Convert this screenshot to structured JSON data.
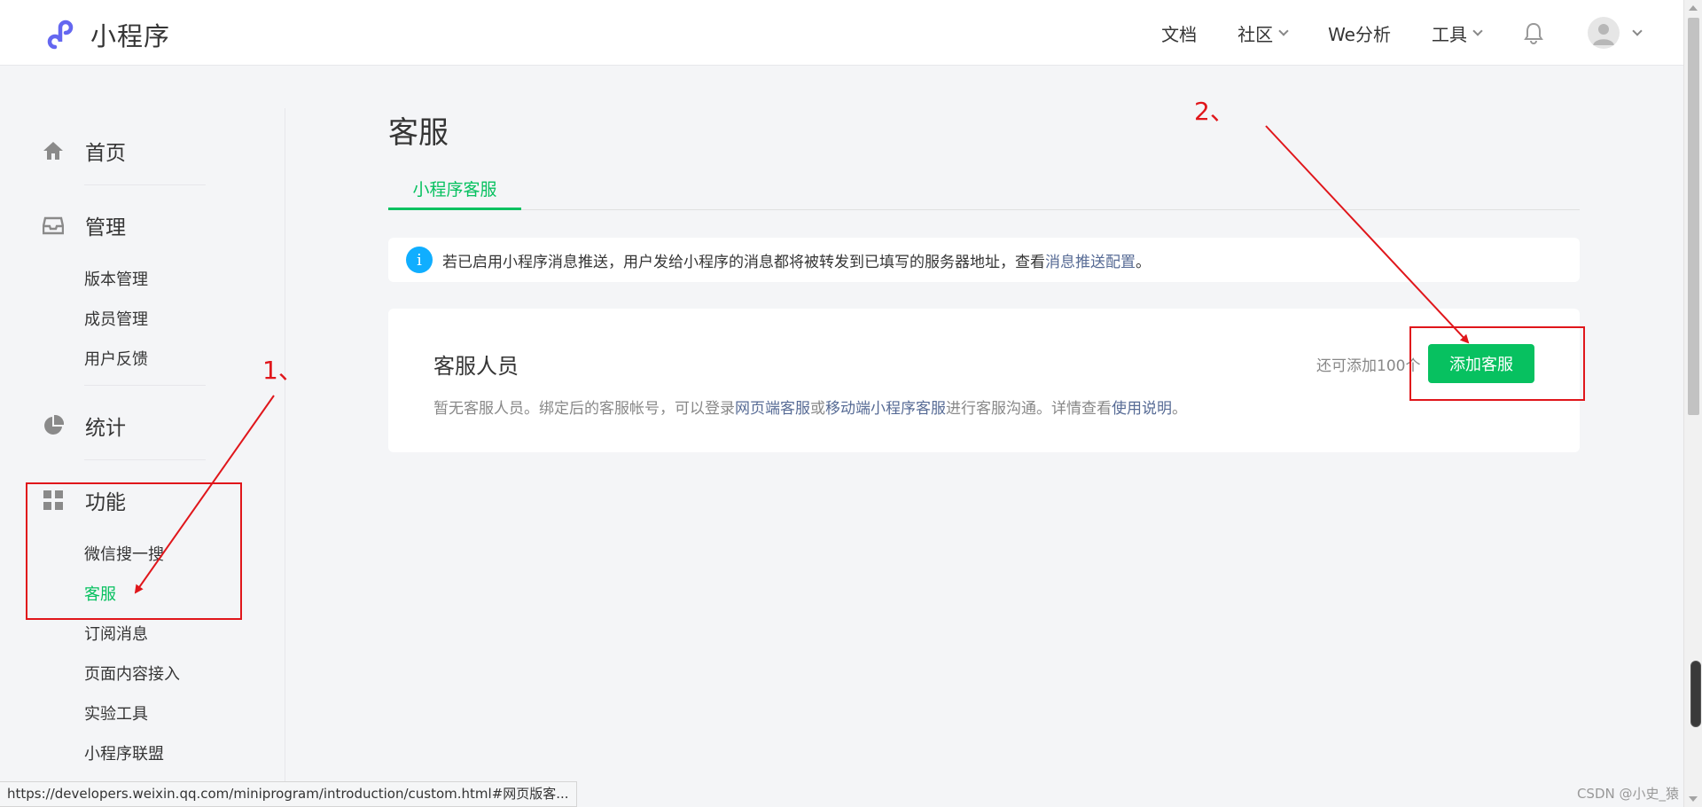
{
  "header": {
    "logo_text": "小程序",
    "nav": [
      {
        "label": "文档",
        "has_dropdown": false
      },
      {
        "label": "社区",
        "has_dropdown": true
      },
      {
        "label": "We分析",
        "has_dropdown": false
      },
      {
        "label": "工具",
        "has_dropdown": true
      }
    ],
    "icons": [
      "notification-bell-icon",
      "user-avatar-icon"
    ]
  },
  "sidebar": {
    "groups": [
      {
        "label": "首页",
        "icon": "home-icon"
      },
      {
        "label": "管理",
        "icon": "inbox-icon"
      },
      {
        "label": "统计",
        "icon": "pie-chart-icon"
      },
      {
        "label": "功能",
        "icon": "grid-icon"
      }
    ],
    "manage_items": [
      "版本管理",
      "成员管理",
      "用户反馈"
    ],
    "feature_items": [
      "微信搜一搜",
      "客服",
      "订阅消息",
      "页面内容接入",
      "实验工具",
      "小程序联盟"
    ],
    "active_item": "客服"
  },
  "main": {
    "title": "客服",
    "tab": "小程序客服",
    "notice": {
      "text": "若已启用小程序消息推送，用户发给小程序的消息都将被转发到已填写的服务器地址，查看 ",
      "link": "消息推送配置",
      "suffix": "。"
    },
    "card": {
      "title": "客服人员",
      "desc_prefix": "暂无客服人员。绑定后的客服帐号，可以登录",
      "link1": "网页端客服",
      "or": "或",
      "link2": "移动端小程序客服",
      "desc_mid": "进行客服沟通。详情查看",
      "link3": "使用说明",
      "desc_suffix": "。",
      "quota": "还可添加100个",
      "button": "添加客服"
    }
  },
  "annotations": {
    "label1": "1、",
    "label2": "2、",
    "color": "#e0161b"
  },
  "status_url": "https://developers.weixin.qq.com/miniprogram/introduction/custom.html#网页版客...",
  "watermark": "CSDN @小史_猿",
  "colors": {
    "accent": "#07c160",
    "link": "#576b95",
    "info": "#10aeff"
  }
}
